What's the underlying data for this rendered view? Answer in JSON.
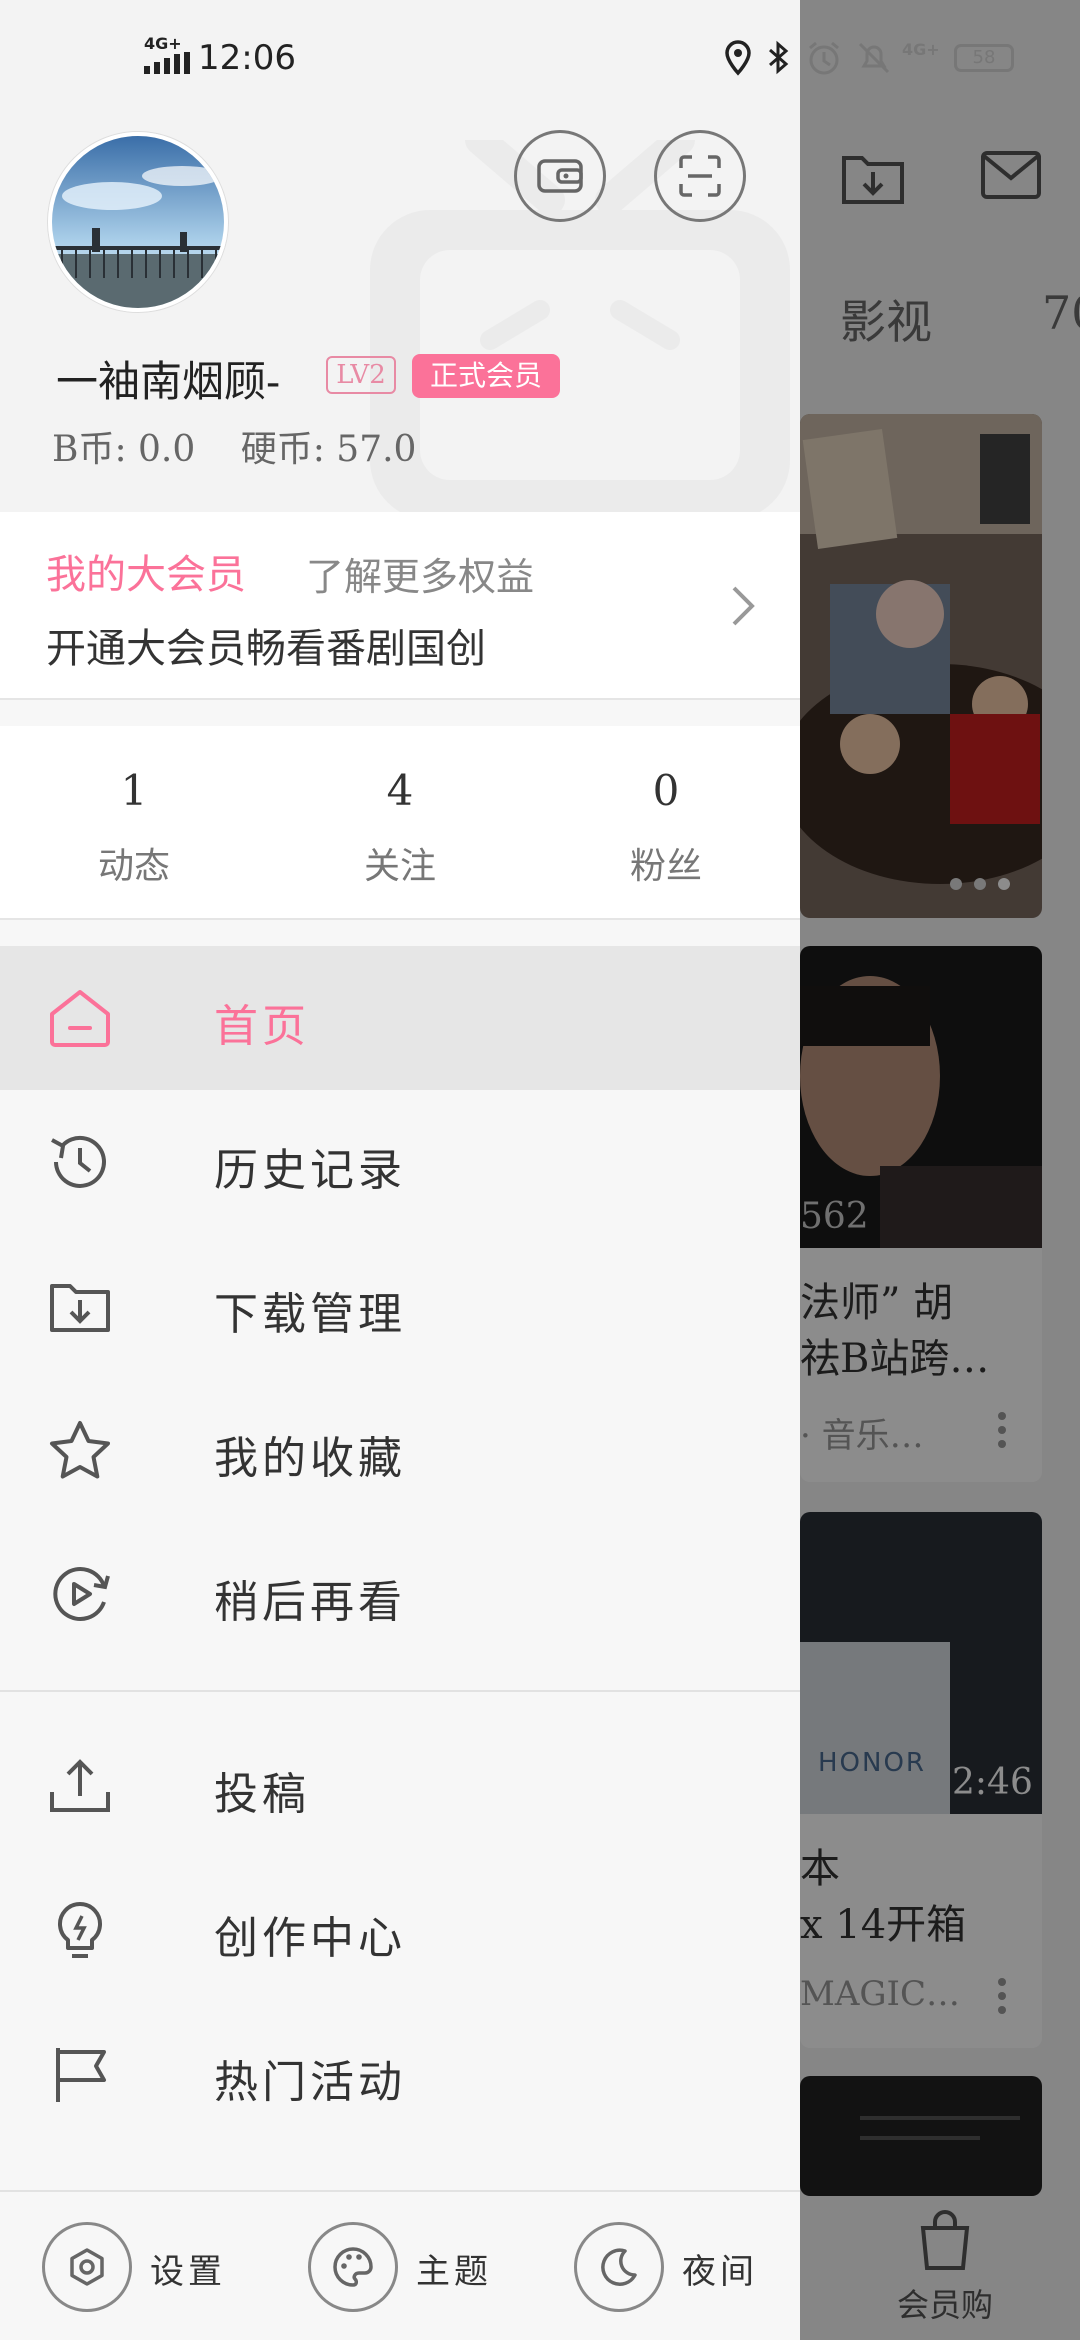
{
  "status_bar": {
    "time": "12:06",
    "network": "4G+",
    "network_right": "4G+",
    "battery": "58"
  },
  "background": {
    "tab_label": "影视",
    "tab_partial": "70",
    "card2": {
      "views": "562",
      "title_line1": "法师” 胡",
      "title_line2": "祛B站跨…",
      "meta": "· 音乐…"
    },
    "card3": {
      "brand": "HONOR",
      "duration": "2:46",
      "title_line1": "本",
      "title_line2": "x 14开箱",
      "meta": "MAGIC…"
    },
    "shop_label": "会员购"
  },
  "profile": {
    "username": "一袖南烟顾-",
    "level": "LV2",
    "vip_badge": "正式会员",
    "b_coin": "B币: 0.0",
    "coin": "硬币: 57.0"
  },
  "vip_card": {
    "title": "我的大会员",
    "more": "了解更多权益",
    "desc": "开通大会员畅看番剧国创"
  },
  "stats": [
    {
      "value": "1",
      "label": "动态"
    },
    {
      "value": "4",
      "label": "关注"
    },
    {
      "value": "0",
      "label": "粉丝"
    }
  ],
  "menu": {
    "home": "首页",
    "history": "历史记录",
    "download": "下载管理",
    "favorites": "我的收藏",
    "watch_later": "稍后再看",
    "upload": "投稿",
    "creator": "创作中心",
    "events": "热门活动"
  },
  "bottom": {
    "settings": "设置",
    "theme": "主题",
    "night": "夜间"
  },
  "colors": {
    "accent": "#fb7299",
    "drawer_bg": "#f7f7f7"
  }
}
